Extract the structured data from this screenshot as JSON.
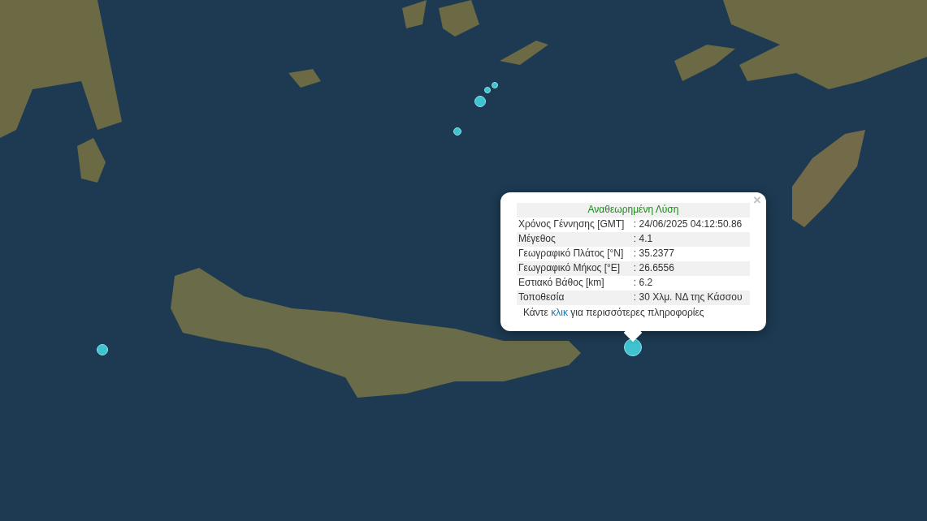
{
  "popup": {
    "close": "×",
    "title": "Αναθεωρημένη Λύση",
    "rows": [
      {
        "label": "Χρόνος Γέννησης [GMT]",
        "value": ": 24/06/2025 04:12:50.86"
      },
      {
        "label": "Μέγεθος",
        "value": ": 4.1"
      },
      {
        "label": "Γεωγραφικό Πλάτος [°N]",
        "value": ": 35.2377"
      },
      {
        "label": "Γεωγραφικό Μήκος [°E]",
        "value": ": 26.6556"
      },
      {
        "label": "Εστιακό Βάθος [km]",
        "value": ": 6.2"
      },
      {
        "label": "Τοποθεσία",
        "value": ": 30 Χλμ. ΝΔ της Κάσσου"
      }
    ],
    "footer": {
      "before": "Κάντε",
      "link": "κλικ",
      "after": "για περισσότερες πληροφορίες"
    }
  }
}
